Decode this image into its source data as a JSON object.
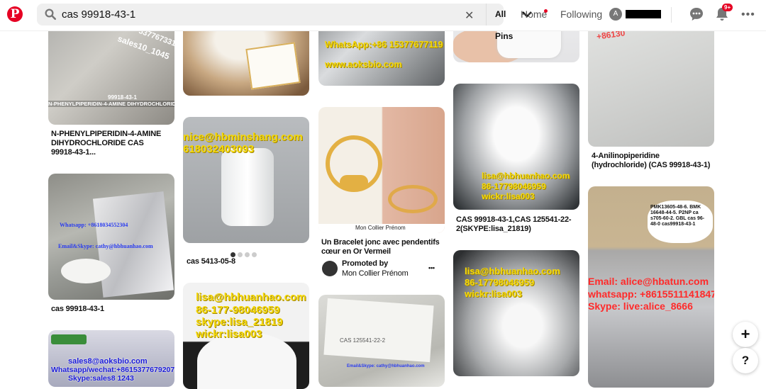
{
  "header": {
    "logo_letter": "P",
    "search_value": "cas 99918-43-1",
    "filter_label": "All Pins",
    "nav_home": "Home",
    "nav_following": "Following",
    "avatar_initial": "A",
    "notification_badge": "9+"
  },
  "pins": [
    {
      "caption": "N-PHENYLPIPERIDIN-4-AMINE DIHYDROCHLORIDE CAS 99918-43-1...",
      "overlay": [
        "99918-43-1",
        "N-PHENYLPIPERIDIN-4-AMINE DIHYDROCHLORIDE",
        "sales10_1045",
        "5377673312"
      ]
    },
    {
      "caption": "",
      "overlay": []
    },
    {
      "caption": "",
      "overlay": [
        "WhatsApp:+86 15377677119",
        "www.aoksbio.com"
      ]
    },
    {
      "caption": "",
      "overlay": []
    },
    {
      "caption": "4-Anilinopiperidine (hydrochloride) (CAS 99918-43-1)",
      "overlay": [
        "+86130"
      ]
    },
    {
      "caption": "cas 5413-05-8",
      "overlay": [
        "nice@hbminshang.com",
        "618032403093"
      ]
    },
    {
      "caption": "cas 99918-43-1",
      "overlay": [
        "Whatsapp: +8618034552304",
        "Email&Skype: cathy@hbhuanhao.com"
      ]
    },
    {
      "caption": "Un Bracelet jonc avec pendentifs cœur en Or Vermeil",
      "overlay": [
        "Mon Collier Prénom"
      ],
      "promoted": "Promoted by",
      "promoter": "Mon Collier Prénom"
    },
    {
      "caption": "CAS 99918-43-1,CAS 125541-22-2(SKYPE:lisa_21819)",
      "overlay": [
        "lisa@hbhuanhao.com",
        "86-17798046959",
        "wickr:lisa003"
      ]
    },
    {
      "caption": "",
      "overlay": [
        "PMK13605-48-6. BMK 16648-44-5. P2NP ca s705-60-2. GBL cas 96-48-0 cas99918-43-1",
        "Email: alice@hbatun.com",
        "whatsapp: +8615511141847",
        "Skype: live:alice_8666"
      ]
    },
    {
      "caption": "",
      "overlay": [
        "lisa@hbhuanhao.com",
        "86-177-98046959",
        "skype:lisa_21819",
        "wickr:lisa003"
      ]
    },
    {
      "caption": "",
      "overlay": [
        "Email&Skype: cathy@hbhuanhao.com",
        "CAS 125541-22-2"
      ]
    },
    {
      "caption": "",
      "overlay": [
        "lisa@hbhuanhao.com",
        "86-17798046959",
        "wickr:lisa003"
      ]
    },
    {
      "caption": "",
      "overlay": [
        "sales8@aoksbio.com",
        "Whatsapp/wechat:+8615377679207",
        "Skype:sales8 1243"
      ]
    }
  ],
  "icons": {
    "search": "search-icon",
    "clear": "close-icon",
    "chevron": "chevron-down-icon",
    "chat": "chat-icon",
    "bell": "bell-icon",
    "more": "more-icon",
    "plus": "plus-icon",
    "help": "help-icon"
  },
  "fab": {
    "plus": "+",
    "help": "?"
  },
  "more_glyph": "•••",
  "colors": {
    "brand": "#e60023"
  }
}
